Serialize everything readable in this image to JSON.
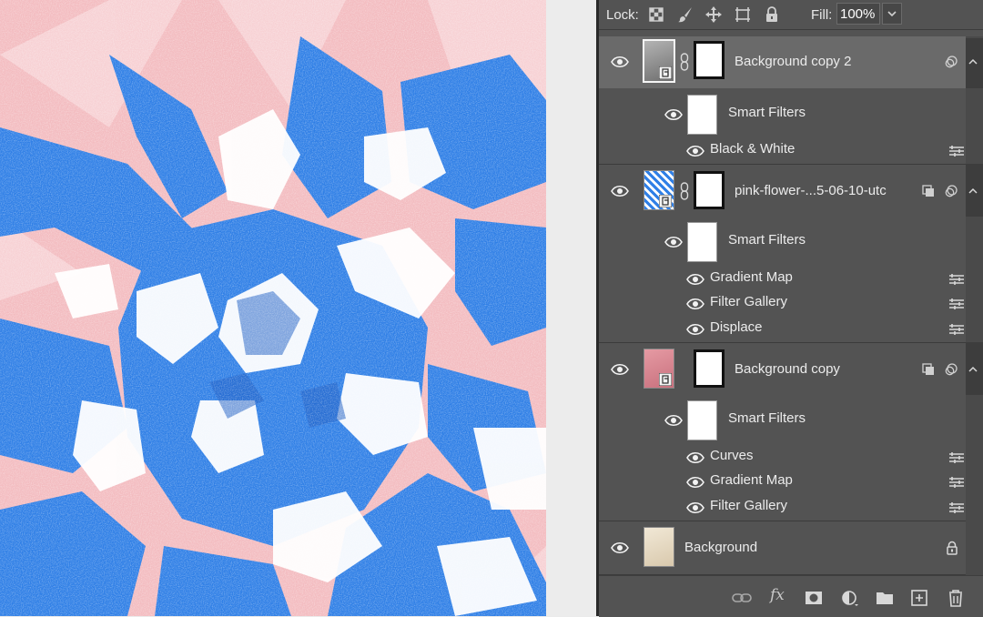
{
  "lock_bar": {
    "lock_label": "Lock:",
    "fill_label": "Fill:",
    "fill_value": "100%"
  },
  "layers": [
    {
      "name": "Background copy 2",
      "selected": true,
      "thumb": "gray-photo",
      "has_mask": true,
      "smart_filters_label": "Smart Filters",
      "filters": [
        "Black & White"
      ],
      "badges": [
        "blend-circle-icon"
      ]
    },
    {
      "name": "pink-flower-...5-06-10-utc",
      "selected": false,
      "thumb": "blue-photo",
      "has_mask": true,
      "smart_filters_label": "Smart Filters",
      "filters": [
        "Gradient Map",
        "Filter Gallery",
        "Displace"
      ],
      "badges": [
        "clip-square-icon",
        "blend-circle-icon"
      ]
    },
    {
      "name": "Background copy",
      "selected": false,
      "thumb": "pink-photo",
      "has_mask": true,
      "smart_filters_label": "Smart Filters",
      "filters": [
        "Curves",
        "Gradient Map",
        "Filter Gallery"
      ],
      "badges": [
        "clip-square-icon",
        "blend-circle-icon"
      ]
    },
    {
      "name": "Background",
      "selected": false,
      "thumb": "paper-photo",
      "has_mask": false,
      "locked": true
    }
  ],
  "bottom_bar": {
    "fx_label": "fx"
  },
  "colors": {
    "panel": "#535353",
    "selected": "#6a6a6a",
    "canvas_pink": "#f2b9bd",
    "canvas_blue": "#2f7fe6"
  }
}
